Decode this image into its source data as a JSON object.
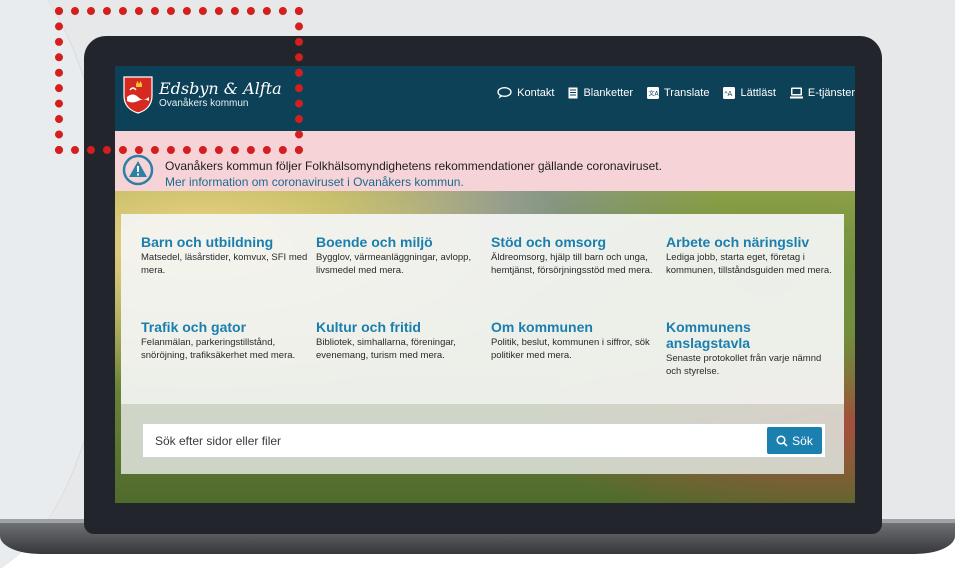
{
  "colors": {
    "header": "#0d4158",
    "alert_bg": "#f6d3d7",
    "link": "#1a7fae",
    "button": "#1b7fb0",
    "highlight": "#d41f1f"
  },
  "logo": {
    "title": "Edsbyn & Alfta",
    "subtitle": "Ovanåkers kommun"
  },
  "nav": [
    {
      "label": "Kontakt",
      "icon": "chat-icon"
    },
    {
      "label": "Blanketter",
      "icon": "document-icon"
    },
    {
      "label": "Translate",
      "icon": "translate-icon"
    },
    {
      "label": "Lättläst",
      "icon": "easy-read-icon"
    },
    {
      "label": "E-tjänster",
      "icon": "computer-icon"
    }
  ],
  "alert": {
    "text": "Ovanåkers kommun följer Folkhälsomyndighetens rekommendationer gällande coronaviruset.",
    "link": "Mer information om coronaviruset i Ovanåkers kommun.",
    "icon": "warning-icon"
  },
  "cards": [
    {
      "title": "Barn och utbildning",
      "desc": "Matsedel, läsårstider, komvux, SFI med mera."
    },
    {
      "title": "Boende och miljö",
      "desc": "Bygglov, värmeanläggningar, avlopp, livsmedel med mera."
    },
    {
      "title": "Stöd och omsorg",
      "desc": "Äldreomsorg, hjälp till barn och unga, hemtjänst, försörjningsstöd med mera."
    },
    {
      "title": "Arbete och näringsliv",
      "desc": "Lediga jobb, starta eget, företag i kommunen, tillståndsguiden med mera."
    },
    {
      "title": "Trafik och gator",
      "desc": "Felanmälan, parkeringstillstånd, snöröjning, trafiksäkerhet med mera."
    },
    {
      "title": "Kultur och fritid",
      "desc": "Bibliotek, simhallarna, föreningar, evenemang, turism med mera."
    },
    {
      "title": "Om kommunen",
      "desc": "Politik, beslut, kommunen i siffror, sök politiker med mera."
    },
    {
      "title": "Kommunens anslagstavla",
      "desc": "Senaste protokollet från varje nämnd och styrelse."
    }
  ],
  "search": {
    "placeholder": "Sök efter sidor eller filer",
    "button": "Sök"
  }
}
